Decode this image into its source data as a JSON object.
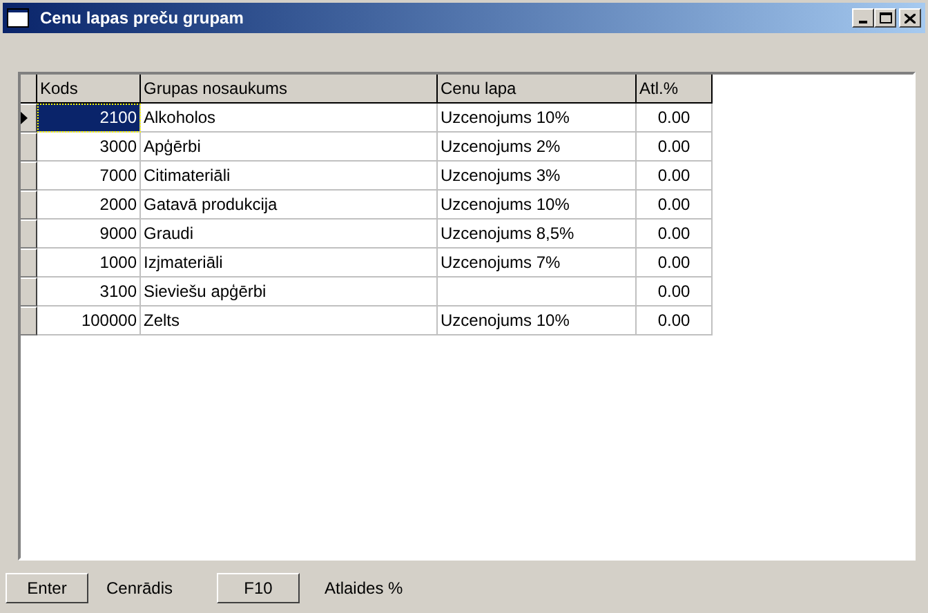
{
  "window": {
    "title": "Cenu lapas preču grupam"
  },
  "table": {
    "columns": [
      "Kods",
      "Grupas nosaukums",
      "Cenu lapa",
      "Atl.%"
    ],
    "rows": [
      {
        "kods": "2100",
        "name": "Alkoholos",
        "price_list": "Uzcenojums 10%",
        "discount": "0.00",
        "selected": true
      },
      {
        "kods": "3000",
        "name": "Apģērbi",
        "price_list": "Uzcenojums 2%",
        "discount": "0.00",
        "selected": false
      },
      {
        "kods": "7000",
        "name": "Citimateriāli",
        "price_list": "Uzcenojums 3%",
        "discount": "0.00",
        "selected": false
      },
      {
        "kods": "2000",
        "name": "Gatavā produkcija",
        "price_list": "Uzcenojums 10%",
        "discount": "0.00",
        "selected": false
      },
      {
        "kods": "9000",
        "name": "Graudi",
        "price_list": "Uzcenojums 8,5%",
        "discount": "0.00",
        "selected": false
      },
      {
        "kods": "1000",
        "name": "Izjmateriāli",
        "price_list": "Uzcenojums 7%",
        "discount": "0.00",
        "selected": false
      },
      {
        "kods": "3100",
        "name": "Sieviešu apģērbi",
        "discount": "0.00",
        "selected": false
      },
      {
        "kods": "100000",
        "name": "Zelts",
        "price_list": "Uzcenojums 10%",
        "discount": "0.00",
        "selected": false
      }
    ]
  },
  "footer": [
    {
      "button": "Enter",
      "label": "Cenrādis"
    },
    {
      "button": "F10",
      "label": "Atlaides %"
    }
  ]
}
